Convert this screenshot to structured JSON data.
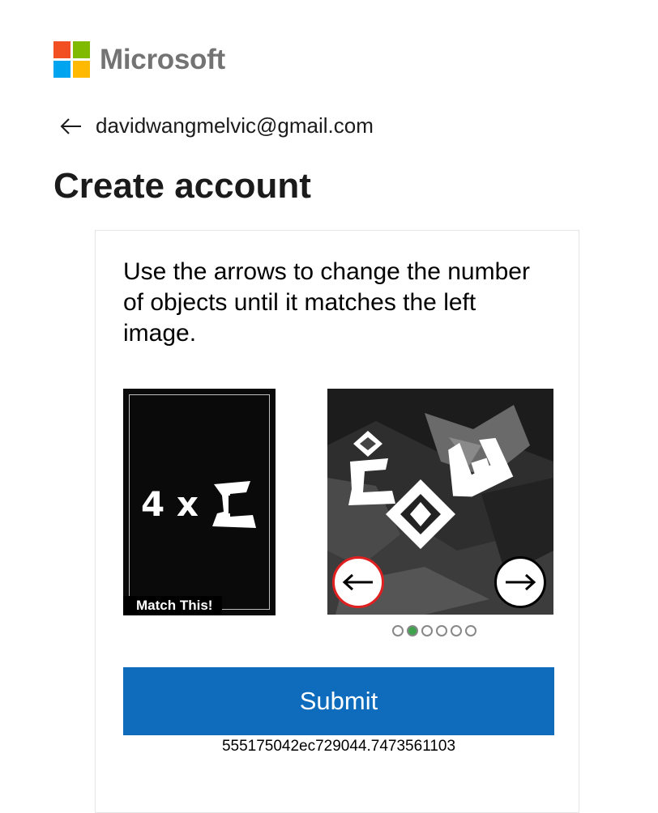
{
  "brand": {
    "name": "Microsoft",
    "colors": {
      "red": "#f25022",
      "green": "#7fba00",
      "blue": "#00a4ef",
      "yellow": "#ffb900"
    }
  },
  "identity": {
    "email": "davidwangmelvic@gmail.com",
    "back_icon": "arrow-left-icon"
  },
  "page": {
    "title": "Create account"
  },
  "challenge": {
    "instruction": "Use the arrows to change the number of objects until it matches the left image.",
    "target_count_text": "4 x",
    "target_label": "Match This!",
    "left_arrow_icon": "arrow-left-icon",
    "right_arrow_icon": "arrow-right-icon",
    "pages_total": 6,
    "current_page": 2,
    "submit_label": "Submit",
    "session_id": "555175042ec729044.7473561103"
  },
  "accent": {
    "submit_bg": "#0f6cbd",
    "active_dot": "#3fa34d",
    "left_arrow_border": "#e02020"
  }
}
